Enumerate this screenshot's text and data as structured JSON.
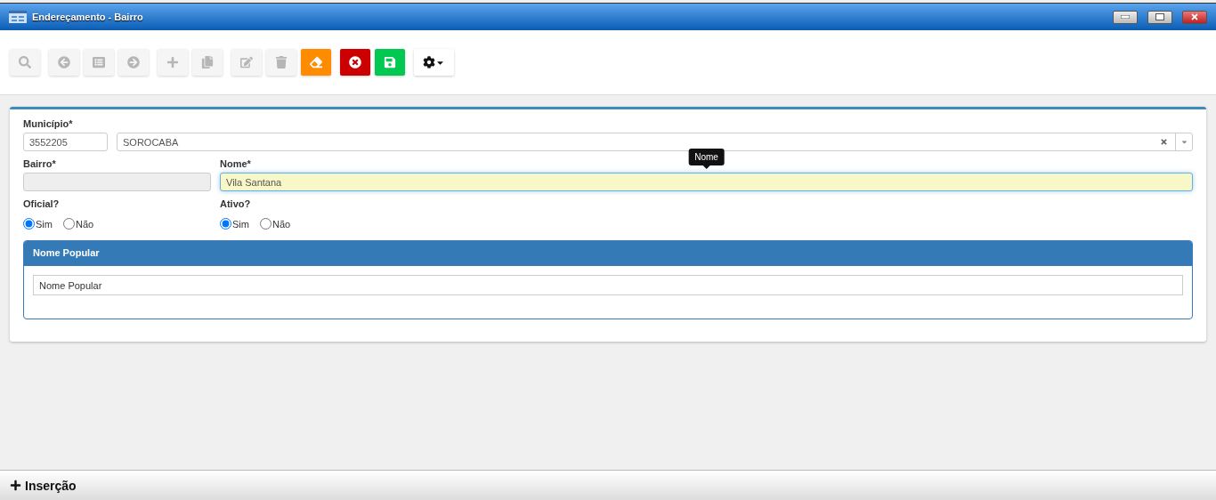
{
  "window": {
    "title": "Endereçamento - Bairro"
  },
  "toolbar": {
    "groups": [
      [
        {
          "kind": "plain",
          "disabled": true
        }
      ],
      [
        {
          "kind": "plain",
          "disabled": true
        },
        {
          "kind": "plain",
          "disabled": true
        },
        {
          "kind": "plain",
          "disabled": true
        }
      ],
      [
        {
          "kind": "plain",
          "disabled": true
        },
        {
          "kind": "plain",
          "disabled": true
        }
      ],
      [
        {
          "kind": "plain",
          "disabled": true
        },
        {
          "kind": "plain",
          "disabled": true
        },
        {
          "kind": "warning",
          "disabled": false
        }
      ],
      [
        {
          "kind": "danger",
          "disabled": false
        },
        {
          "kind": "success",
          "disabled": false
        }
      ],
      [
        {
          "kind": "light",
          "disabled": false
        }
      ]
    ]
  },
  "form": {
    "municipio": {
      "label": "Município*",
      "code": "3552205",
      "name": "SOROCABA"
    },
    "bairro": {
      "label": "Bairro*",
      "disabled": true
    },
    "nome": {
      "label": "Nome*",
      "value": "Vila Santana",
      "focused": true,
      "tooltip": "Nome"
    },
    "oficial": {
      "label": "Oficial?",
      "options": [
        {
          "label": "Sim",
          "selected": true
        },
        {
          "label": "Não",
          "selected": false
        }
      ]
    },
    "ativo": {
      "label": "Ativo?",
      "options": [
        {
          "label": "Sim",
          "selected": true
        },
        {
          "label": "Não",
          "selected": false
        }
      ]
    },
    "nome_popular": {
      "title": "Nome Popular",
      "placeholder": "Nome Popular"
    }
  },
  "status_bar": {
    "label": "Inserção"
  }
}
